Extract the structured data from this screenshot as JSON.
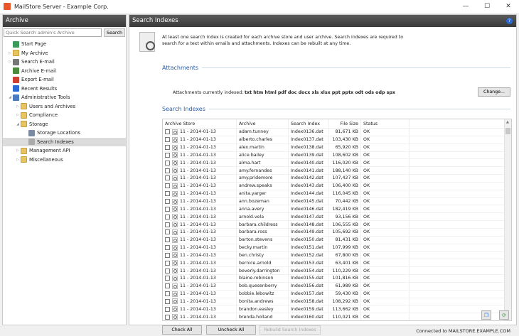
{
  "window": {
    "title": "MailStore Server - Example Corp.",
    "controls": [
      "—",
      "☐",
      "✕"
    ]
  },
  "left": {
    "header": "Archive",
    "search_placeholder": "Quick Search admin's Archive",
    "search_button": "Search",
    "tree": [
      {
        "label": "Start Page",
        "level": 0,
        "arrow": "",
        "icon": "start-page-icon",
        "color": "#3a9a5a"
      },
      {
        "label": "My Archive",
        "level": 0,
        "arrow": "▷",
        "icon": "folder-icon",
        "color": ""
      },
      {
        "label": "Search E-mail",
        "level": 0,
        "arrow": "▷",
        "icon": "magnifier-icon",
        "color": "#777"
      },
      {
        "label": "Archive E-mail",
        "level": 0,
        "arrow": "",
        "icon": "archive-email-icon",
        "color": "#4a8a3a"
      },
      {
        "label": "Export E-mail",
        "level": 0,
        "arrow": "",
        "icon": "export-email-icon",
        "color": "#d04030"
      },
      {
        "label": "Recent Results",
        "level": 0,
        "arrow": "",
        "icon": "recent-results-icon",
        "color": "#2a6ad4"
      },
      {
        "label": "Administrative Tools",
        "level": 0,
        "arrow": "◢",
        "icon": "admin-tools-icon",
        "color": "#4a7ac0"
      },
      {
        "label": "Users and Archives",
        "level": 1,
        "arrow": "▷",
        "icon": "folder-icon",
        "color": ""
      },
      {
        "label": "Compliance",
        "level": 1,
        "arrow": "▷",
        "icon": "folder-icon",
        "color": ""
      },
      {
        "label": "Storage",
        "level": 1,
        "arrow": "◢",
        "icon": "folder-icon",
        "color": ""
      },
      {
        "label": "Storage Locations",
        "level": 2,
        "arrow": "",
        "icon": "storage-locations-icon",
        "color": "#7a8aa0"
      },
      {
        "label": "Search Indexes",
        "level": 2,
        "arrow": "",
        "icon": "search-index-icon",
        "color": "#aaa",
        "selected": true
      },
      {
        "label": "Management API",
        "level": 1,
        "arrow": "▷",
        "icon": "folder-icon",
        "color": ""
      },
      {
        "label": "Miscellaneous",
        "level": 1,
        "arrow": "▷",
        "icon": "folder-icon",
        "color": ""
      }
    ]
  },
  "main": {
    "header": "Search Indexes",
    "help": "?",
    "intro": "At least one search index is created for each archive store and user archive. Search indexes are required to search for a text within emails and attachments. Indexes can be rebuilt at any time.",
    "attachments_title": "Attachments",
    "attachments_label": "Attachments currently indexed:",
    "attachments_value": "txt htm html pdf doc docx xls xlsx ppt pptx odt ods odp spx",
    "change_button": "Change...",
    "indexes_title": "Search Indexes",
    "columns": [
      "Archive Store",
      "Archive",
      "Search Index",
      "File Size",
      "Status"
    ],
    "rows": [
      [
        "11 - 2014-01-13",
        "adam.tunney",
        "Index0136.dat",
        "81,671 KB",
        "OK"
      ],
      [
        "11 - 2014-01-13",
        "alberto.charles",
        "Index0137.dat",
        "103,430 KB",
        "OK"
      ],
      [
        "11 - 2014-01-13",
        "alex.martin",
        "Index0138.dat",
        "65,920 KB",
        "OK"
      ],
      [
        "11 - 2014-01-13",
        "alice.bailey",
        "Index0139.dat",
        "108,602 KB",
        "OK"
      ],
      [
        "11 - 2014-01-13",
        "alma.hart",
        "Index0140.dat",
        "116,020 KB",
        "OK"
      ],
      [
        "11 - 2014-01-13",
        "amy.fernandes",
        "Index0141.dat",
        "188,140 KB",
        "OK"
      ],
      [
        "11 - 2014-01-13",
        "amy.pridemore",
        "Index0142.dat",
        "107,427 KB",
        "OK"
      ],
      [
        "11 - 2014-01-13",
        "andrew.speaks",
        "Index0143.dat",
        "106,400 KB",
        "OK"
      ],
      [
        "11 - 2014-01-13",
        "anita.yarger",
        "Index0144.dat",
        "116,045 KB",
        "OK"
      ],
      [
        "11 - 2014-01-13",
        "ann.bozeman",
        "Index0145.dat",
        "70,442 KB",
        "OK"
      ],
      [
        "11 - 2014-01-13",
        "anna.avery",
        "Index0146.dat",
        "182,419 KB",
        "OK"
      ],
      [
        "11 - 2014-01-13",
        "arnold.vela",
        "Index0147.dat",
        "93,156 KB",
        "OK"
      ],
      [
        "11 - 2014-01-13",
        "barbara.childress",
        "Index0148.dat",
        "106,555 KB",
        "OK"
      ],
      [
        "11 - 2014-01-13",
        "barbara.ross",
        "Index0149.dat",
        "105,692 KB",
        "OK"
      ],
      [
        "11 - 2014-01-13",
        "barton.stevens",
        "Index0150.dat",
        "81,431 KB",
        "OK"
      ],
      [
        "11 - 2014-01-13",
        "becky.martin",
        "Index0151.dat",
        "107,999 KB",
        "OK"
      ],
      [
        "11 - 2014-01-13",
        "ben.christy",
        "Index0152.dat",
        "67,800 KB",
        "OK"
      ],
      [
        "11 - 2014-01-13",
        "bernice.arnold",
        "Index0153.dat",
        "63,401 KB",
        "OK"
      ],
      [
        "11 - 2014-01-13",
        "beverly.darrington",
        "Index0154.dat",
        "110,229 KB",
        "OK"
      ],
      [
        "11 - 2014-01-13",
        "blaine.robinson",
        "Index0155.dat",
        "101,816 KB",
        "OK"
      ],
      [
        "11 - 2014-01-13",
        "bob.quesenberry",
        "Index0156.dat",
        "61,989 KB",
        "OK"
      ],
      [
        "11 - 2014-01-13",
        "bobbie.lebowitz",
        "Index0157.dat",
        "59,430 KB",
        "OK"
      ],
      [
        "11 - 2014-01-13",
        "bonita.andrews",
        "Index0158.dat",
        "108,292 KB",
        "OK"
      ],
      [
        "11 - 2014-01-13",
        "brandon.easley",
        "Index0159.dat",
        "113,662 KB",
        "OK"
      ],
      [
        "11 - 2014-01-13",
        "brenda.holland",
        "Index0160.dat",
        "110,021 KB",
        "OK"
      ]
    ],
    "check_all": "Check All",
    "uncheck_all": "Uncheck All",
    "rebuild": "Rebuild Search Indexes"
  },
  "status": "Connected to MAILSTORE.EXAMPLE.COM"
}
